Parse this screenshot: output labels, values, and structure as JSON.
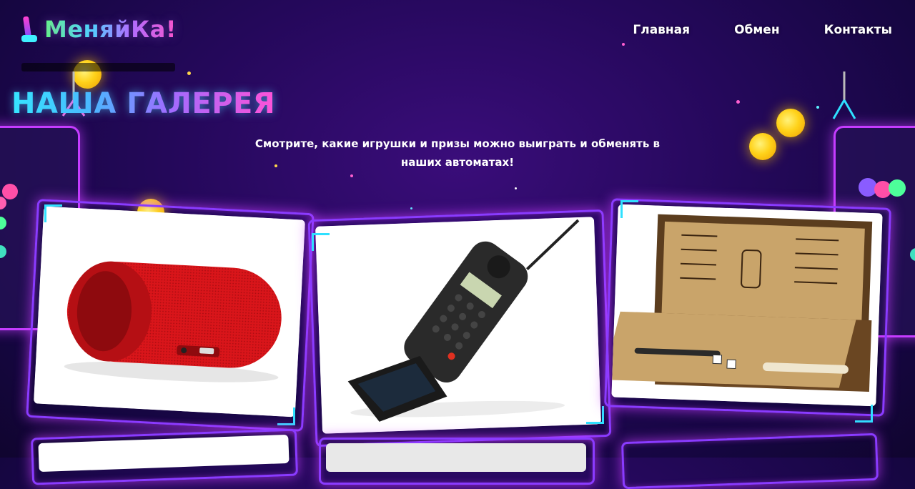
{
  "header": {
    "logo_text": "МеняйКа!",
    "nav": [
      {
        "label": "Главная"
      },
      {
        "label": "Обмен"
      },
      {
        "label": "Контакты"
      }
    ]
  },
  "gallery": {
    "title": "НАША ГАЛЕРЕЯ",
    "subtitle": "Смотрите, какие игрушки и призы можно выиграть и обменять в наших автоматах!",
    "items": [
      {
        "name": "speaker",
        "icon": "bluetooth-speaker-image"
      },
      {
        "name": "phone",
        "icon": "flip-phone-image"
      },
      {
        "name": "backgammon",
        "icon": "backgammon-board-image"
      }
    ]
  },
  "colors": {
    "accent_cyan": "#2fe0ff",
    "accent_magenta": "#c53cff",
    "background": "#24085a"
  }
}
